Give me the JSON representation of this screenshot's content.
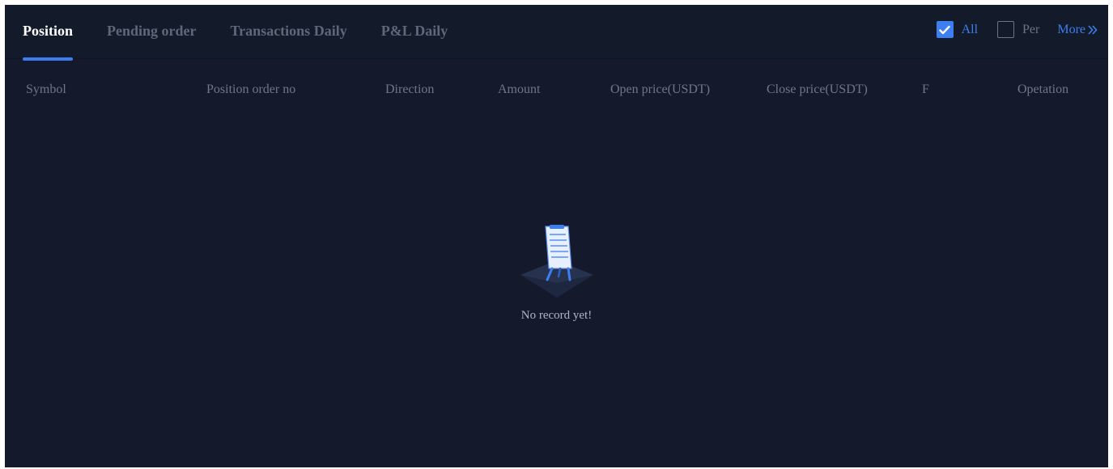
{
  "tabs": [
    {
      "label": "Position",
      "active": true
    },
    {
      "label": "Pending order",
      "active": false
    },
    {
      "label": "Transactions Daily",
      "active": false
    },
    {
      "label": "P&L Daily",
      "active": false
    }
  ],
  "filters": {
    "all": {
      "label": "All",
      "checked": true
    },
    "per": {
      "label": "Per",
      "checked": false
    },
    "more_label": "More"
  },
  "table": {
    "headers": [
      "Symbol",
      "Position order no",
      "Direction",
      "Amount",
      "Open price(USDT)",
      "Close price(USDT)",
      "F",
      "Opetation"
    ]
  },
  "empty_state": {
    "message": "No record yet!",
    "icon": "empty-document-icon"
  },
  "colors": {
    "background": "#141a2b",
    "accent": "#3d7ef0",
    "muted_text": "#6e7787",
    "active_tab": "#ffffff"
  }
}
